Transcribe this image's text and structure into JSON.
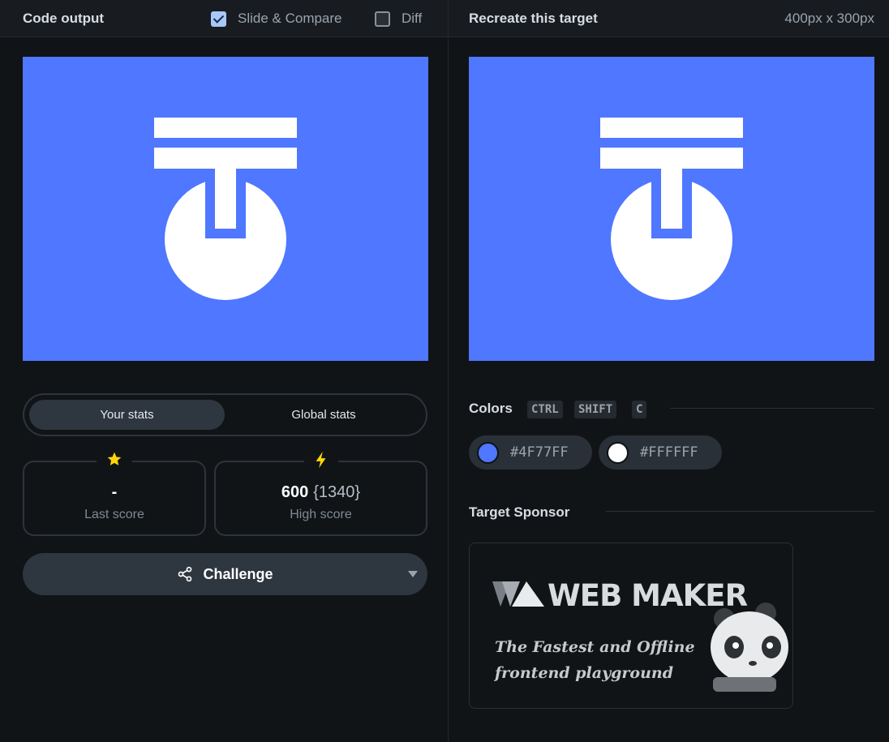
{
  "left_header": {
    "title": "Code output",
    "slide_compare": {
      "label": "Slide & Compare",
      "checked": true
    },
    "diff": {
      "label": "Diff",
      "checked": false
    }
  },
  "right_header": {
    "title": "Recreate this target",
    "dimensions": "400px x 300px"
  },
  "stats": {
    "tabs": [
      "Your stats",
      "Global stats"
    ],
    "active_tab": "Your stats",
    "last_score": {
      "value": "-",
      "label": "Last score",
      "icon": "star-icon"
    },
    "high_score": {
      "value": "600",
      "sub": "{1340}",
      "label": "High score",
      "icon": "bolt-icon"
    }
  },
  "challenge": {
    "label": "Challenge",
    "icon": "share-icon"
  },
  "colors": {
    "title": "Colors",
    "shortcut": [
      "CTRL",
      "SHIFT",
      "C"
    ],
    "swatches": [
      {
        "hex": "#4F77FF"
      },
      {
        "hex": "#FFFFFF"
      }
    ]
  },
  "sponsor": {
    "title": "Target Sponsor",
    "logo_text": "WEB MAKER",
    "tagline_1": "The Fastest and Offline",
    "tagline_2": "frontend playground"
  },
  "target_colors": {
    "background": "#4F77FF",
    "shape": "#FFFFFF"
  }
}
